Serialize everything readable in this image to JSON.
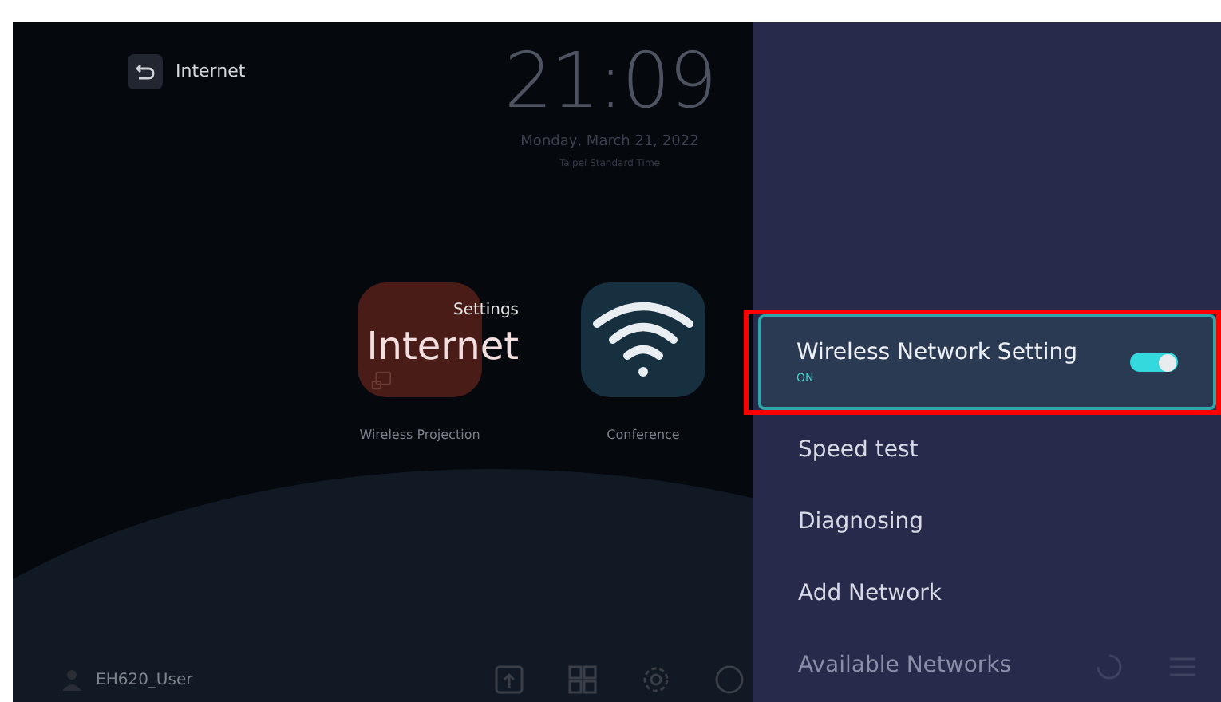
{
  "back": {
    "label": "Internet"
  },
  "clock": {
    "time": "21:09",
    "date": "Monday, March 21, 2022",
    "timezone": "Taipei Standard Time"
  },
  "apps": [
    {
      "label": "Wireless Projection",
      "kind": "projection"
    },
    {
      "label": "Conference",
      "kind": "wifi"
    }
  ],
  "overlay": {
    "caption": "Settings",
    "title": "Internet"
  },
  "user": {
    "name": "EH620_User"
  },
  "menu": [
    {
      "label": "Wireless Network Setting",
      "status": "ON",
      "on": true,
      "selected": true,
      "annotated": true,
      "kind": "toggle"
    },
    {
      "label": "Speed test",
      "selected": false,
      "kind": "item"
    },
    {
      "label": "Diagnosing",
      "selected": false,
      "kind": "item"
    },
    {
      "label": "Add Network",
      "selected": false,
      "kind": "item"
    },
    {
      "label": "Available Networks",
      "selected": false,
      "kind": "header"
    }
  ]
}
